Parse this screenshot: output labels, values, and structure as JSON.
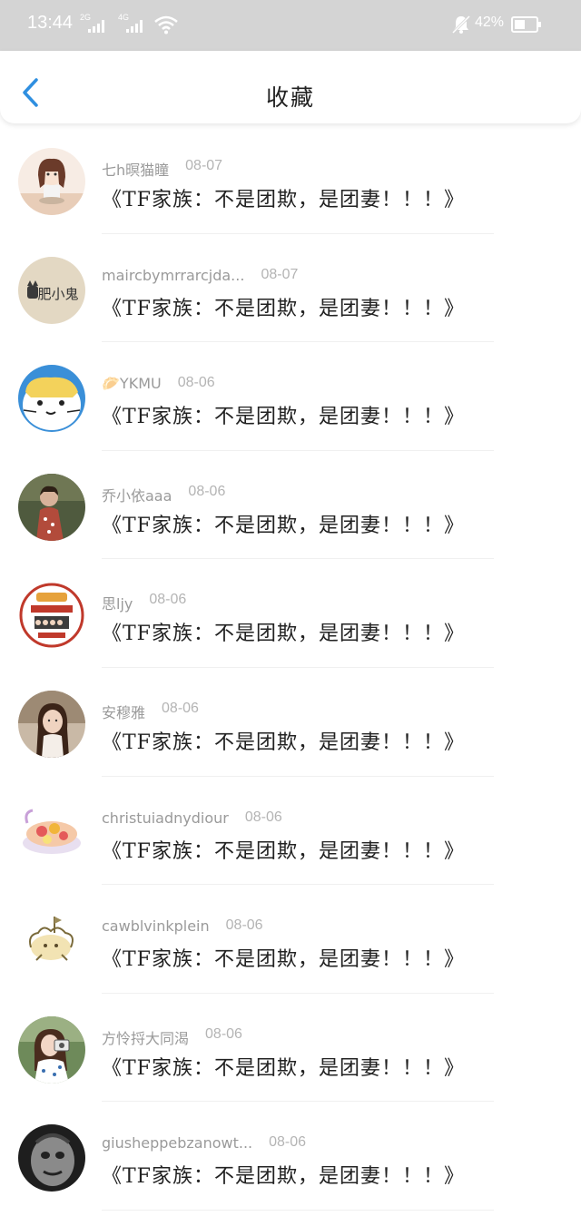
{
  "status_bar": {
    "time": "13:44",
    "sim1_tag": "2G",
    "sim2_tag": "4G",
    "battery": "42%",
    "icons": [
      "signal-icon",
      "wifi-icon",
      "mute-icon",
      "battery-icon"
    ]
  },
  "header": {
    "back_icon": "chevron-left-icon",
    "title": "收藏"
  },
  "colors": {
    "accent": "#2f8fe0",
    "status_bar_bg": "#d4d4d4",
    "name_text": "#9a9a9a",
    "date_text": "#b4b4b4"
  },
  "favorites": [
    {
      "user": "七h暝猫瞳",
      "date": "08-07",
      "title": "《TF家族：不是团欺，是团妻！！！》"
    },
    {
      "user": "maircbymrrarcjda...",
      "date": "08-07",
      "title": "《TF家族：不是团欺，是团妻！！！》"
    },
    {
      "user": "🥟YKMU",
      "date": "08-06",
      "title": "《TF家族：不是团欺，是团妻！！！》"
    },
    {
      "user": "乔小依aaa",
      "date": "08-06",
      "title": "《TF家族：不是团欺，是团妻！！！》"
    },
    {
      "user": "思ljy",
      "date": "08-06",
      "title": "《TF家族：不是团欺，是团妻！！！》"
    },
    {
      "user": "安穆雅",
      "date": "08-06",
      "title": "《TF家族：不是团欺，是团妻！！！》"
    },
    {
      "user": "christuiadnydiour",
      "date": "08-06",
      "title": "《TF家族：不是团欺，是团妻！！！》"
    },
    {
      "user": "cawblvinkplein",
      "date": "08-06",
      "title": "《TF家族：不是团欺，是团妻！！！》"
    },
    {
      "user": "方怜捋大同渴",
      "date": "08-06",
      "title": "《TF家族：不是团欺，是团妻！！！》"
    },
    {
      "user": "giusheppebzanowt...",
      "date": "08-06",
      "title": "《TF家族：不是团欺，是团妻！！！》"
    }
  ],
  "avatars": [
    {
      "icon": "avatar-girl-cartoon-icon",
      "logo_text": ""
    },
    {
      "icon": "avatar-cat-logo-icon",
      "logo_text": "肥小鬼"
    },
    {
      "icon": "avatar-cartoon-cat-icon",
      "logo_text": ""
    },
    {
      "icon": "avatar-child-photo-icon",
      "logo_text": ""
    },
    {
      "icon": "avatar-badge-collage-icon",
      "logo_text": ""
    },
    {
      "icon": "avatar-woman-photo-icon",
      "logo_text": ""
    },
    {
      "icon": "avatar-food-bowl-icon",
      "logo_text": ""
    },
    {
      "icon": "avatar-sketch-creature-icon",
      "logo_text": ""
    },
    {
      "icon": "avatar-girl-camera-icon",
      "logo_text": ""
    },
    {
      "icon": "avatar-dark-face-icon",
      "logo_text": ""
    }
  ]
}
